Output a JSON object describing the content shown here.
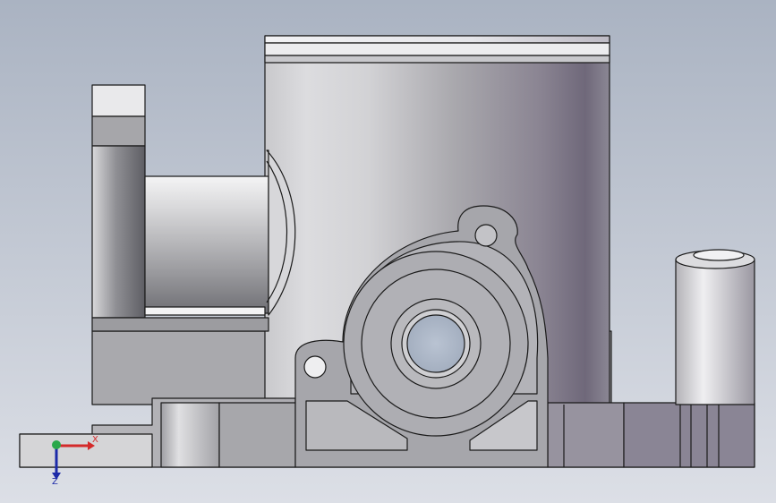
{
  "viewport": {
    "background_top": "#aab3c2",
    "background_bottom": "#d9dde4"
  },
  "triad": {
    "x_label": "X",
    "z_label": "Z",
    "x_color": "#d42a2a",
    "y_color": "#2aa84a",
    "z_color": "#1c2aa8"
  },
  "model": {
    "outline_color": "#1a1a1a",
    "face_light": "#e8e8ea",
    "face_mid": "#b9b9bd",
    "face_dark": "#7d7a86",
    "face_deep": "#5e5868"
  }
}
